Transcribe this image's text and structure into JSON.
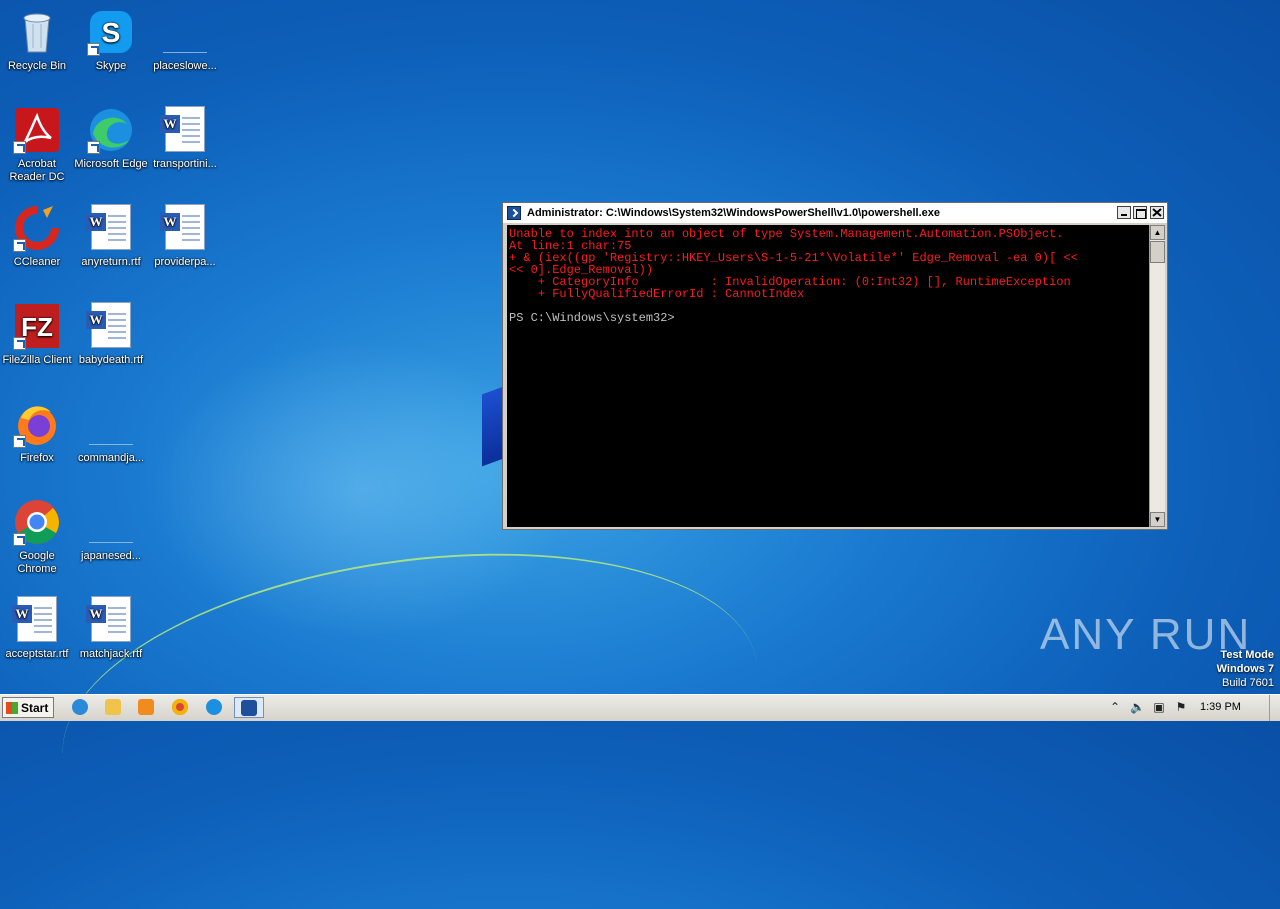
{
  "desktop": {
    "icons": [
      {
        "label": "Recycle Bin",
        "icon": "recycle-bin-icon"
      },
      {
        "label": "Skype",
        "icon": "skype-icon"
      },
      {
        "label": "placeslowe...",
        "icon": "blank-file-icon"
      },
      {
        "label": "Acrobat Reader DC",
        "icon": "acrobat-icon"
      },
      {
        "label": "Microsoft Edge",
        "icon": "edge-icon"
      },
      {
        "label": "transportini...",
        "icon": "word-doc-icon"
      },
      {
        "label": "CCleaner",
        "icon": "ccleaner-icon"
      },
      {
        "label": "anyreturn.rtf",
        "icon": "word-doc-icon"
      },
      {
        "label": "providerpa...",
        "icon": "word-doc-icon"
      },
      {
        "label": "FileZilla Client",
        "icon": "filezilla-icon"
      },
      {
        "label": "babydeath.rtf",
        "icon": "word-doc-icon"
      },
      {
        "label": "Firefox",
        "icon": "firefox-icon"
      },
      {
        "label": "commandja...",
        "icon": "blank-file-icon"
      },
      {
        "label": "Google Chrome",
        "icon": "chrome-icon"
      },
      {
        "label": "japanesed...",
        "icon": "blank-file-icon"
      },
      {
        "label": "acceptstar.rtf",
        "icon": "word-doc-icon"
      },
      {
        "label": "matchjack.rtf",
        "icon": "word-doc-icon"
      }
    ]
  },
  "window": {
    "title": "Administrator: C:\\Windows\\System32\\WindowsPowerShell\\v1.0\\powershell.exe",
    "console": {
      "error_lines": [
        "Unable to index into an object of type System.Management.Automation.PSObject.",
        "At line:1 char:75",
        "+ & (iex((gp 'Registry::HKEY_Users\\S-1-5-21*\\Volatile*' Edge_Removal -ea 0)[ <<",
        "<< 0].Edge_Removal))",
        "    + CategoryInfo          : InvalidOperation: (0:Int32) [], RuntimeException",
        "    + FullyQualifiedErrorId : CannotIndex"
      ],
      "prompt": "PS C:\\Windows\\system32>"
    }
  },
  "watermark": {
    "brand": "ANY RUN",
    "test_mode": "Test Mode",
    "os": "Windows 7",
    "build": "Build 7601"
  },
  "taskbar": {
    "start_label": "Start",
    "clock": "1:39 PM",
    "pinned": [
      "ie-icon",
      "explorer-icon",
      "media-player-icon",
      "chrome-icon",
      "edge-icon",
      "powershell-icon"
    ]
  }
}
